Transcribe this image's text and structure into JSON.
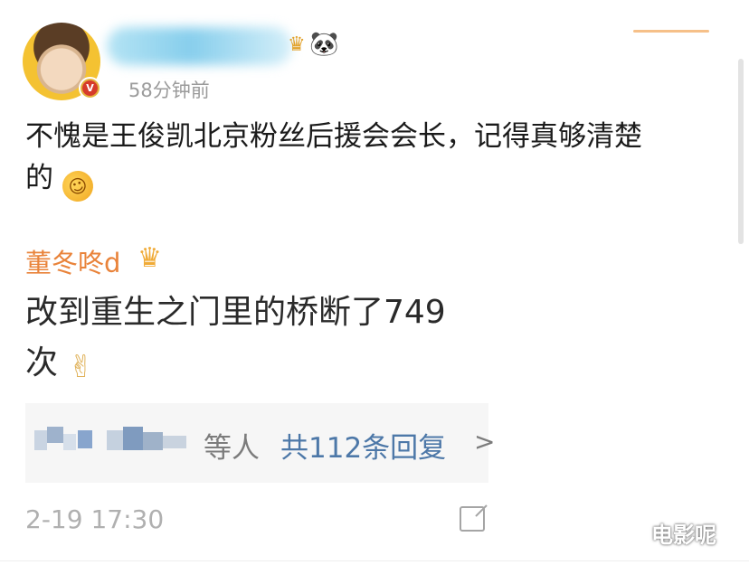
{
  "post": {
    "author_name": "",
    "time_ago": "58分钟前",
    "content_line1": "不愧是王俊凯北京粉丝后援会会长，记得真够清楚",
    "content_line2": "的",
    "verified_badge": "V",
    "emoji": "rolling-on-floor-laughing"
  },
  "reply": {
    "username": "董冬咚d",
    "text_line1": "改到重生之门里的桥断了749",
    "text_line2": "次",
    "emoji": "✌"
  },
  "replies_summary": {
    "others_text": "等人",
    "count_link": "共112条回复",
    "chevron": ">"
  },
  "footer": {
    "timestamp": "2-19 17:30"
  },
  "watermark": "电影呢",
  "colors": {
    "username": "#e9833a",
    "link": "#4d78a8",
    "muted": "#9b9b9b"
  }
}
